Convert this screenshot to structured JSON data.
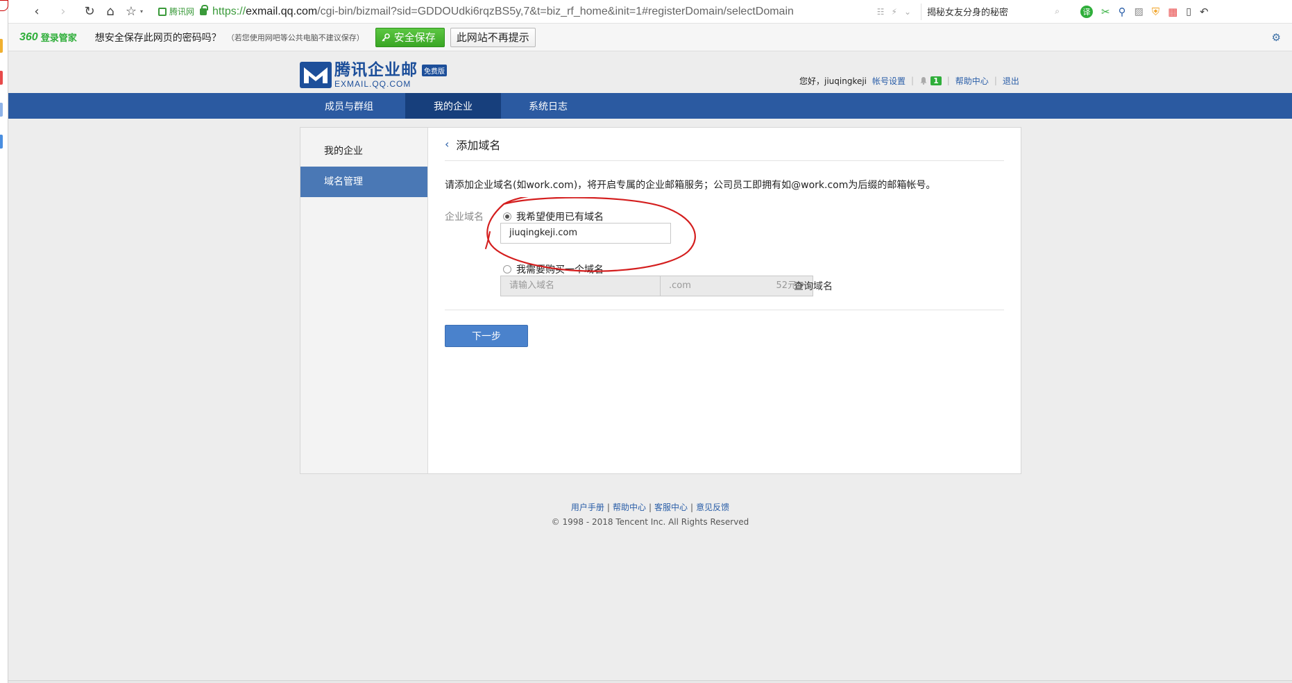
{
  "browser": {
    "url_site_badge": "腾讯网",
    "url_https": "https://",
    "url_host": "exmail.qq.com",
    "url_rest": "/cgi-bin/bizmail?sid=GDDOUdki6rqzBS5y,7&t=biz_rf_home&init=1#registerDomain/selectDomain",
    "search_text": "揭秘女友分身的秘密"
  },
  "password_bar": {
    "logo": "360",
    "logo_sub": "登录管家",
    "question": "想安全保存此网页的密码吗？",
    "note": "（若您使用网吧等公共电脑不建议保存）",
    "save_label": "安全保存",
    "never_label": "此网站不再提示"
  },
  "header": {
    "brand_cn": "腾讯企业邮",
    "brand_en": "EXMAIL.QQ.COM",
    "free_badge": "免费版",
    "greeting": "您好，jiuqingkeji",
    "account_settings": "帐号设置",
    "notif_count": "1",
    "help": "帮助中心",
    "logout": "退出"
  },
  "nav": {
    "tabs": [
      "成员与群组",
      "我的企业",
      "系统日志"
    ],
    "active_index": 1
  },
  "sidebar": {
    "items": [
      "我的企业",
      "域名管理"
    ],
    "active_index": 1
  },
  "content": {
    "title": "添加域名",
    "description": "请添加企业域名(如work.com)，将开启专属的企业邮箱服务；公司员工即拥有如@work.com为后缀的邮箱帐号。",
    "field_label": "企业域名",
    "option_existing": "我希望使用已有域名",
    "existing_value": "jiuqingkeji.com",
    "option_buy": "我需要购买一个域名",
    "buy_placeholder": "请输入域名",
    "suffix": ".com",
    "price": "52元",
    "query_label": "查询域名",
    "next_label": "下一步"
  },
  "footer": {
    "links": [
      "用户手册",
      "帮助中心",
      "客服中心",
      "意见反馈"
    ],
    "copyright": "© 1998 - 2018 Tencent Inc. All Rights Reserved"
  },
  "colors": {
    "nav_bg": "#2b5aa1",
    "nav_active": "#173f7c",
    "sidebar_active": "#4a78b5",
    "button_primary": "#4a82cc",
    "annotation": "#d41e1e",
    "save_green": "#3aa625"
  }
}
